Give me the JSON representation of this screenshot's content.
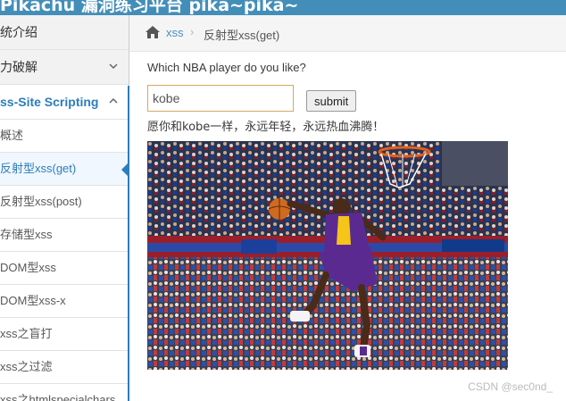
{
  "topbar": {
    "title": "Pikachu 漏洞练习平台 pika~pika~"
  },
  "sidebar": {
    "items": [
      {
        "label": "统介绍",
        "level": 1,
        "chevron": false
      },
      {
        "label": "力破解",
        "level": 1,
        "chevron": true
      },
      {
        "label": "ss-Site Scripting",
        "level": 1,
        "chevron": true,
        "expanded": true
      },
      {
        "label": "概述",
        "level": 2
      },
      {
        "label": "反射型xss(get)",
        "level": 2,
        "selected": true
      },
      {
        "label": "反射型xss(post)",
        "level": 2
      },
      {
        "label": "存储型xss",
        "level": 2
      },
      {
        "label": "DOM型xss",
        "level": 2
      },
      {
        "label": "DOM型xss-x",
        "level": 2
      },
      {
        "label": "xss之盲打",
        "level": 2
      },
      {
        "label": "xss之过滤",
        "level": 2
      },
      {
        "label": "xss之htmlspecialchars",
        "level": 2
      }
    ]
  },
  "breadcrumb": {
    "link": "xss",
    "separator": "›",
    "current": "反射型xss(get)"
  },
  "main": {
    "question": "Which NBA player do you like?",
    "input_value": "kobe",
    "submit_label": "submit",
    "result_text": "愿你和kobe一样，永远年轻，永远热血沸腾！",
    "image_alt": "kobe"
  },
  "watermark": "CSDN @sec0nd_",
  "colors": {
    "topbar": "#438eb9",
    "accent": "#2b7dbc",
    "link": "#4c8fbd"
  }
}
